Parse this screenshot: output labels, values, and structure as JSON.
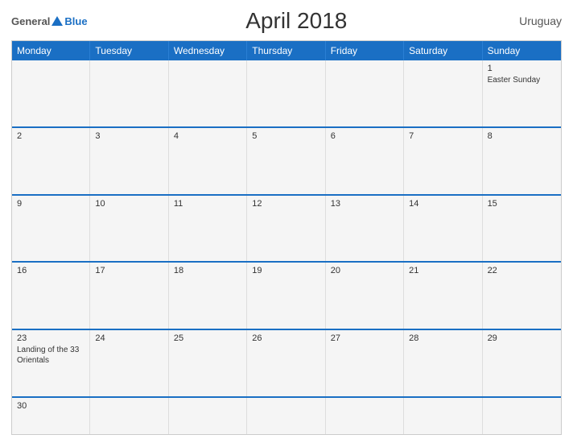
{
  "header": {
    "logo_general": "General",
    "logo_blue": "Blue",
    "title": "April 2018",
    "country": "Uruguay"
  },
  "days": [
    "Monday",
    "Tuesday",
    "Wednesday",
    "Thursday",
    "Friday",
    "Saturday",
    "Sunday"
  ],
  "weeks": [
    [
      {
        "date": "",
        "event": ""
      },
      {
        "date": "",
        "event": ""
      },
      {
        "date": "",
        "event": ""
      },
      {
        "date": "",
        "event": ""
      },
      {
        "date": "",
        "event": ""
      },
      {
        "date": "",
        "event": ""
      },
      {
        "date": "1",
        "event": "Easter Sunday"
      }
    ],
    [
      {
        "date": "2",
        "event": ""
      },
      {
        "date": "3",
        "event": ""
      },
      {
        "date": "4",
        "event": ""
      },
      {
        "date": "5",
        "event": ""
      },
      {
        "date": "6",
        "event": ""
      },
      {
        "date": "7",
        "event": ""
      },
      {
        "date": "8",
        "event": ""
      }
    ],
    [
      {
        "date": "9",
        "event": ""
      },
      {
        "date": "10",
        "event": ""
      },
      {
        "date": "11",
        "event": ""
      },
      {
        "date": "12",
        "event": ""
      },
      {
        "date": "13",
        "event": ""
      },
      {
        "date": "14",
        "event": ""
      },
      {
        "date": "15",
        "event": ""
      }
    ],
    [
      {
        "date": "16",
        "event": ""
      },
      {
        "date": "17",
        "event": ""
      },
      {
        "date": "18",
        "event": ""
      },
      {
        "date": "19",
        "event": ""
      },
      {
        "date": "20",
        "event": ""
      },
      {
        "date": "21",
        "event": ""
      },
      {
        "date": "22",
        "event": ""
      }
    ],
    [
      {
        "date": "23",
        "event": "Landing of the 33 Orientals"
      },
      {
        "date": "24",
        "event": ""
      },
      {
        "date": "25",
        "event": ""
      },
      {
        "date": "26",
        "event": ""
      },
      {
        "date": "27",
        "event": ""
      },
      {
        "date": "28",
        "event": ""
      },
      {
        "date": "29",
        "event": ""
      }
    ],
    [
      {
        "date": "30",
        "event": ""
      },
      {
        "date": "",
        "event": ""
      },
      {
        "date": "",
        "event": ""
      },
      {
        "date": "",
        "event": ""
      },
      {
        "date": "",
        "event": ""
      },
      {
        "date": "",
        "event": ""
      },
      {
        "date": "",
        "event": ""
      }
    ]
  ]
}
